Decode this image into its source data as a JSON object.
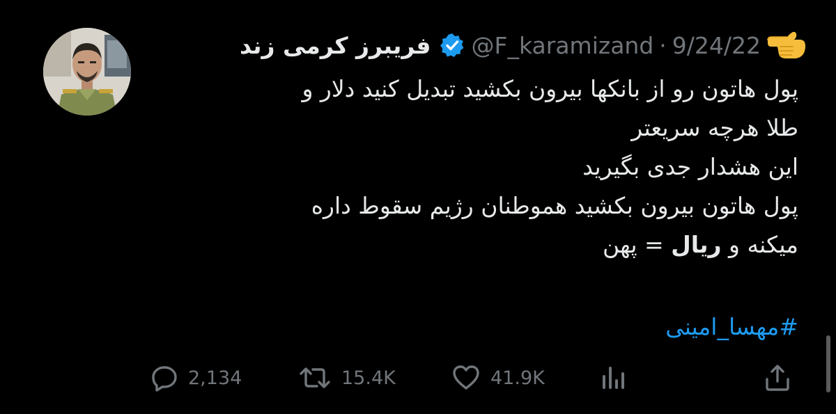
{
  "tweet": {
    "display_name": "فریبرز کرمی زند",
    "handle": "@F_karamizand",
    "separator": "·",
    "date": "9/24/22",
    "body_lines": [
      "پول هاتون رو از بانکها بیرون بکشید تبدیل کنید دلار و",
      "طلا هرچه سریعتر",
      "این هشدار جدی بگیرید",
      "پول هاتون بیرون بکشید هموطنان رژیم سقوط داره"
    ],
    "last_line": {
      "before": "میکنه و ",
      "bold": "ریال",
      "after": " = پهن"
    },
    "hashtag": "#مهسا_امینی",
    "stats": {
      "replies": "2,134",
      "retweets": "15.4K",
      "likes": "41.9K"
    }
  },
  "icons": {
    "verified": "verified-badge-icon",
    "pointing_hand": "pointing-hand-emoji-icon",
    "reply": "reply-icon",
    "retweet": "retweet-icon",
    "like": "heart-icon",
    "views": "views-icon",
    "share": "share-icon"
  },
  "colors": {
    "background": "#000000",
    "text": "#e7e9ea",
    "muted": "#71767b",
    "accent": "#1d9bf0"
  }
}
